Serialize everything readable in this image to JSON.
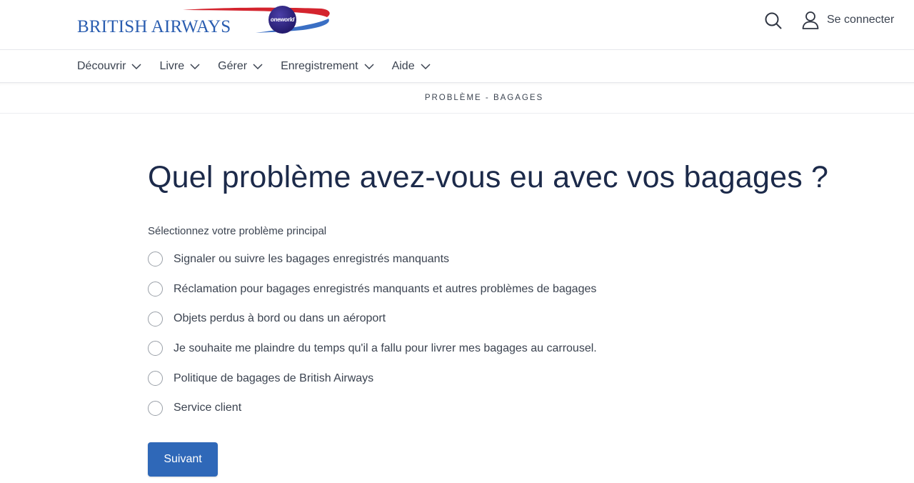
{
  "header": {
    "brand": "BRITISH AIRWAYS",
    "alliance": "oneworld",
    "login_label": "Se connecter",
    "search_icon": "search-icon",
    "user_icon": "user-icon"
  },
  "nav": {
    "items": [
      {
        "label": "Découvrir"
      },
      {
        "label": "Livre"
      },
      {
        "label": "Gérer"
      },
      {
        "label": "Enregistrement"
      },
      {
        "label": "Aide"
      }
    ]
  },
  "breadcrumb": "PROBLÈME - BAGAGES",
  "main": {
    "title": "Quel problème avez-vous eu avec vos bagages ?",
    "question_label": "Sélectionnez votre problème principal",
    "options": [
      {
        "label": "Signaler ou suivre les bagages enregistrés manquants"
      },
      {
        "label": "Réclamation pour bagages enregistrés manquants et autres problèmes de bagages"
      },
      {
        "label": "Objets perdus à bord ou dans un aéroport"
      },
      {
        "label": "Je souhaite me plaindre du temps qu'il a fallu pour livrer mes bagages au carrousel."
      },
      {
        "label": "Politique de bagages de British Airways"
      },
      {
        "label": "Service client"
      }
    ],
    "next_label": "Suivant"
  },
  "colors": {
    "brand_blue": "#2a5db0",
    "speedmarque_red": "#d4242e",
    "button_blue": "#2f68b8",
    "title_navy": "#1c2a4a"
  }
}
